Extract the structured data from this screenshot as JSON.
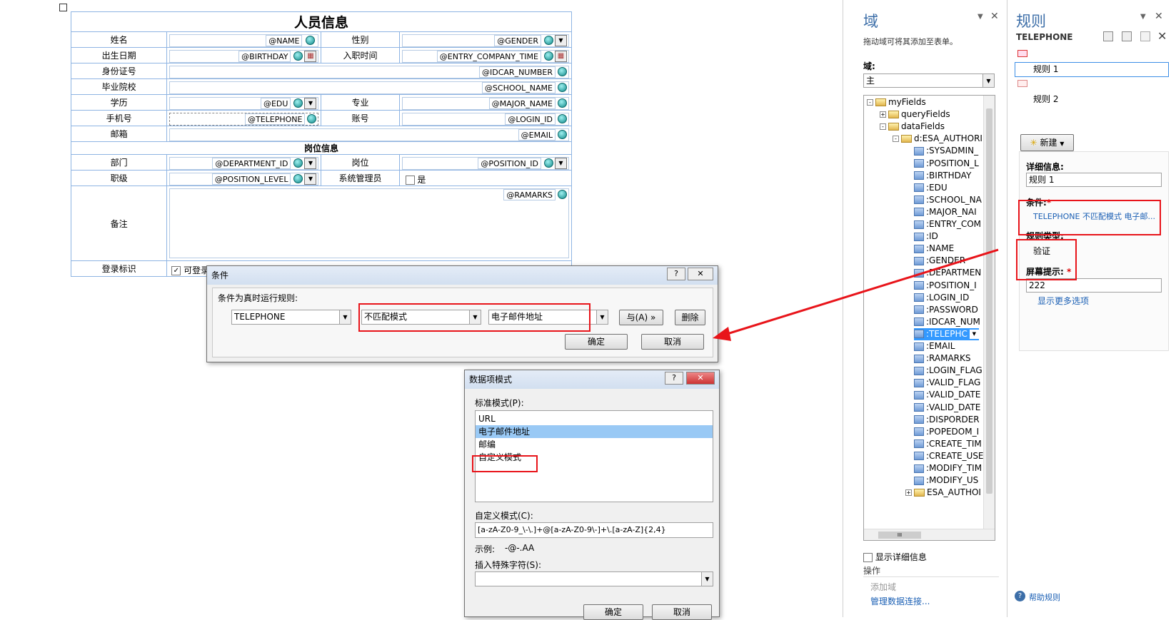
{
  "form": {
    "title": "人员信息",
    "section_title": "岗位信息",
    "rows": {
      "name_label": "姓名",
      "name_field": "@NAME",
      "gender_label": "性别",
      "gender_field": "@GENDER",
      "birthday_label": "出生日期",
      "birthday_field": "@BIRTHDAY",
      "entry_label": "入职时间",
      "entry_field": "@ENTRY_COMPANY_TIME",
      "idcard_label": "身份证号",
      "idcard_field": "@IDCAR_NUMBER",
      "school_label": "毕业院校",
      "school_field": "@SCHOOL_NAME",
      "edu_label": "学历",
      "edu_field": "@EDU",
      "major_label": "专业",
      "major_field": "@MAJOR_NAME",
      "phone_label": "手机号",
      "phone_field": "@TELEPHONE",
      "account_label": "账号",
      "account_field": "@LOGIN_ID",
      "email_label": "邮箱",
      "email_field": "@EMAIL",
      "dept_label": "部门",
      "dept_field": "@DEPARTMENT_ID",
      "position_label": "岗位",
      "position_field": "@POSITION_ID",
      "level_label": "职级",
      "level_field": "@POSITION_LEVEL",
      "admin_label": "系统管理员",
      "admin_check": "是",
      "remarks_label": "备注",
      "remarks_field": "@RAMARKS",
      "login_label": "登录标识",
      "login_check": "可登录"
    }
  },
  "condition_dialog": {
    "title": "条件",
    "help": "?",
    "close": "✕",
    "prompt": "条件为真时运行规则:",
    "field": "TELEPHONE",
    "operator": "不匹配模式",
    "value": "电子邮件地址",
    "and_button": "与(A) »",
    "delete_button": "删除",
    "ok_button": "确定",
    "cancel_button": "取消"
  },
  "pattern_dialog": {
    "title": "数据项模式",
    "help": "?",
    "close": "✕",
    "standard_label": "标准模式(P):",
    "standard_options": [
      "URL",
      "电子邮件地址",
      "邮编",
      "自定义模式"
    ],
    "custom_label": "自定义模式(C):",
    "custom_value": "[a-zA-Z0-9_\\-\\.]+@[a-zA-Z0-9\\-]+\\.[a-zA-Z]{2,4}",
    "example_label": "示例:",
    "example_value": "-@-.AA",
    "insert_label": "插入特殊字符(S):",
    "ok_button": "确定",
    "cancel_button": "取消"
  },
  "fields_panel": {
    "title": "域",
    "subtitle": "拖动域可将其添加至表单。",
    "domain_label": "域:",
    "domain_value": "主",
    "tree": {
      "root": "myFields",
      "query": "queryFields",
      "data": "dataFields",
      "group": "d:ESA_AUTHORI",
      "items": [
        ":SYSADMIN_",
        ":POSITION_L",
        ":BIRTHDAY",
        ":EDU",
        ":SCHOOL_NA",
        ":MAJOR_NAI",
        ":ENTRY_COM",
        ":ID",
        ":NAME",
        ":GENDER",
        ":DEPARTMEN",
        ":POSITION_I",
        ":LOGIN_ID",
        ":PASSWORD",
        ":IDCAR_NUM",
        ":TELEPHC",
        ":EMAIL",
        ":RAMARKS",
        ":LOGIN_FLAG",
        ":VALID_FLAG",
        ":VALID_DATE",
        ":VALID_DATE",
        ":DISPORDER",
        ":POPEDOM_I",
        ":CREATE_TIM",
        ":CREATE_USE",
        ":MODIFY_TIM",
        ":MODIFY_US"
      ],
      "tail": "ESA_AUTHOI"
    },
    "scroll_mark": "III",
    "show_details": "显示详细信息",
    "actions_label": "操作",
    "add_field": "添加域",
    "manage_link": "管理数据连接..."
  },
  "rules_panel": {
    "title": "规则",
    "field_name": "TELEPHONE",
    "rule1": "规则 1",
    "rule2": "规则 2",
    "new_button": "新建",
    "details_label": "详细信息:",
    "rule_name_value": "规则 1",
    "condition_label": "条件:",
    "required_mark": "*",
    "condition_value": "TELEPHONE 不匹配模式 电子邮...",
    "rule_type_label": "规则类型:",
    "rule_type_value": "验证",
    "screen_tip_label": "屏幕提示:",
    "screen_tip_value": "222",
    "more_options": "显示更多选项",
    "help_link": "帮助规则"
  },
  "colors": {
    "accent": "#3c6ea8",
    "highlight_red": "#e8141a",
    "selection": "#99c9f5"
  }
}
